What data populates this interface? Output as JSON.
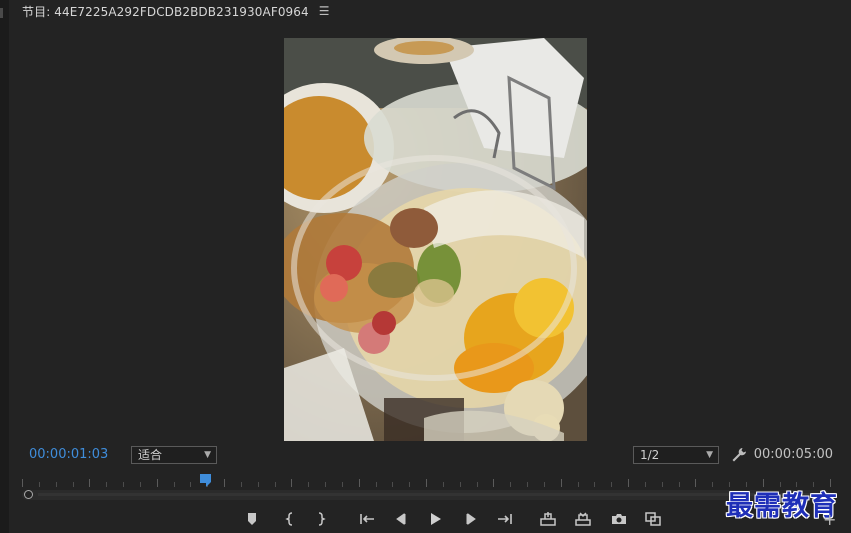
{
  "panel": {
    "title": "节目: 44E7225A292FDCDB2BDB231930AF0964",
    "menu_icon": "hamburger-icon"
  },
  "timecode": {
    "current": "00:00:01:03",
    "duration": "00:00:05:00"
  },
  "fit_select": {
    "value": "适合"
  },
  "resolution_select": {
    "value": "1/2"
  },
  "playhead": {
    "position_fraction": 0.228
  },
  "transport": [
    {
      "name": "add-marker-icon"
    },
    {
      "name": "mark-in-icon"
    },
    {
      "name": "mark-out-icon"
    },
    {
      "name": "go-to-in-icon"
    },
    {
      "name": "step-back-icon"
    },
    {
      "name": "play-icon"
    },
    {
      "name": "step-forward-icon"
    },
    {
      "name": "go-to-out-icon"
    },
    {
      "name": "lift-icon"
    },
    {
      "name": "extract-icon"
    },
    {
      "name": "export-frame-icon"
    },
    {
      "name": "comparison-view-icon"
    }
  ],
  "watermark": "最需教育",
  "colors": {
    "accent": "#3f8ddb",
    "background": "#232323",
    "watermark": "#1f2fb8"
  }
}
